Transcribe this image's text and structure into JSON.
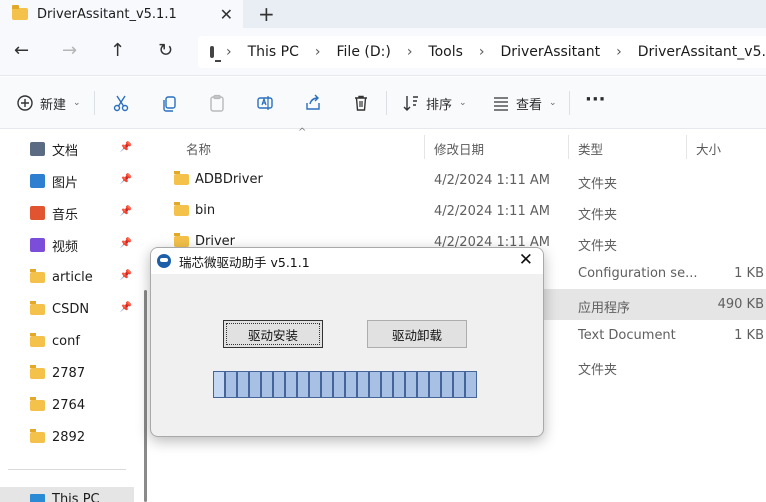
{
  "tab": {
    "title": "DriverAssitant_v5.1.1",
    "close": "✕",
    "new": "+"
  },
  "nav": {
    "back": "←",
    "forward": "→",
    "up": "↑",
    "refresh": "↻"
  },
  "address": {
    "crumbs": [
      "This PC",
      "File (D:)",
      "Tools",
      "DriverAssitant",
      "DriverAssitant_v5.1.1"
    ],
    "separator": "›"
  },
  "commands": {
    "new_label": "新建",
    "sort_label": "排序",
    "view_label": "查看",
    "more": "···"
  },
  "sidebar": {
    "items": [
      {
        "label": "文档",
        "icon": "document-icon",
        "color": "#5b6b82",
        "pinned": true
      },
      {
        "label": "图片",
        "icon": "pictures-icon",
        "color": "#2f7fd1",
        "pinned": true
      },
      {
        "label": "音乐",
        "icon": "music-icon",
        "color": "#e0552f",
        "pinned": true
      },
      {
        "label": "视频",
        "icon": "video-icon",
        "color": "#7a4ed8",
        "pinned": true
      },
      {
        "label": "article",
        "icon": "folder-icon",
        "color": "#f4c14a",
        "pinned": true
      },
      {
        "label": "CSDN",
        "icon": "folder-icon",
        "color": "#f4c14a",
        "pinned": true
      },
      {
        "label": "conf",
        "icon": "folder-icon",
        "color": "#f4c14a",
        "pinned": false
      },
      {
        "label": "2787",
        "icon": "folder-icon",
        "color": "#f4c14a",
        "pinned": false
      },
      {
        "label": "2764",
        "icon": "folder-icon",
        "color": "#f4c14a",
        "pinned": false
      },
      {
        "label": "2892",
        "icon": "folder-icon",
        "color": "#f4c14a",
        "pinned": false
      }
    ],
    "this_pc": "This PC"
  },
  "columns": {
    "name": "名称",
    "date": "修改日期",
    "type": "类型",
    "size": "大小"
  },
  "files": [
    {
      "name": "ADBDriver",
      "date": "4/2/2024 1:11 AM",
      "type": "文件夹",
      "size": ""
    },
    {
      "name": "bin",
      "date": "4/2/2024 1:11 AM",
      "type": "文件夹",
      "size": ""
    },
    {
      "name": "Driver",
      "date": "4/2/2024 1:11 AM",
      "type": "文件夹",
      "size": ""
    },
    {
      "name": "",
      "date": "",
      "type": "Configuration se...",
      "size": "1 KB"
    },
    {
      "name": "",
      "date": "M",
      "type": "应用程序",
      "size": "490 KB"
    },
    {
      "name": "",
      "date": "",
      "type": "Text Document",
      "size": "1 KB"
    },
    {
      "name": "",
      "date": "",
      "type": "文件夹",
      "size": ""
    }
  ],
  "dialog": {
    "title": "瑞芯微驱动助手 v5.1.1",
    "close": "✕",
    "install_label": "驱动安装",
    "uninstall_label": "驱动卸载",
    "progress_segments": 22,
    "progress_color": "#a7c0e4"
  }
}
